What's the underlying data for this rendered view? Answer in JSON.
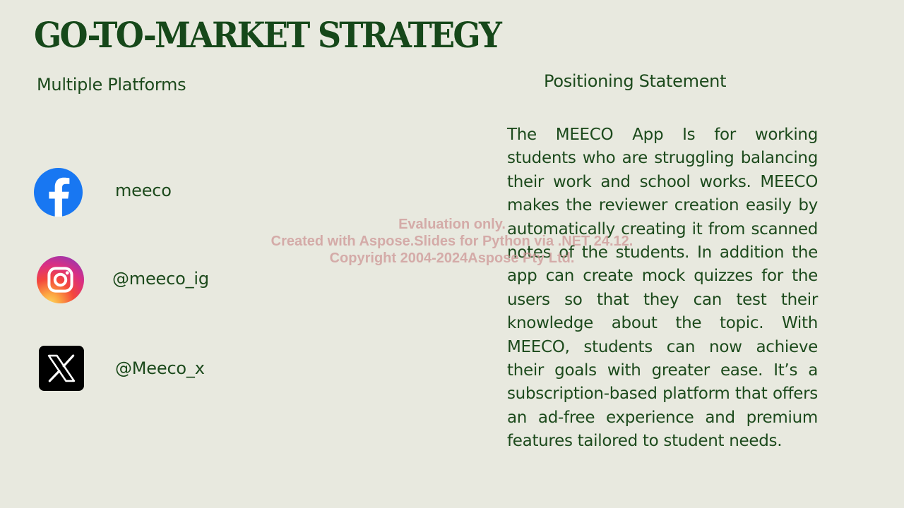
{
  "slide": {
    "title": "GO-TO-MARKET STRATEGY"
  },
  "platforms": {
    "heading": "Multiple Platforms",
    "items": [
      {
        "icon": "facebook-icon",
        "handle": "meeco"
      },
      {
        "icon": "instagram-icon",
        "handle": "@meeco_ig"
      },
      {
        "icon": "x-icon",
        "handle": "@Meeco_x"
      }
    ]
  },
  "positioning": {
    "heading": "Positioning Statement",
    "body": "The MEECO App Is for working students who are struggling balancing their work and school works. MEECO makes the reviewer creation easily by automatically creating it from scanned notes of the students. In addition the app can create mock quizzes for the users so that they can test their knowledge about the topic. With MEECO, students can now achieve their goals with greater ease. It’s a subscription-based platform that offers an ad-free experience and premium features tailored to student needs."
  },
  "watermark": {
    "line1": "Evaluation only.",
    "line2": "Created with Aspose.Slides for Python via .NET 24.12.",
    "line3": "Copyright 2004-2024Aspose Pty Ltd."
  },
  "colors": {
    "background": "#e8e9df",
    "text": "#1c4a1c",
    "facebook": "#1877f2",
    "x": "#000000",
    "watermark": "#cd9696"
  }
}
